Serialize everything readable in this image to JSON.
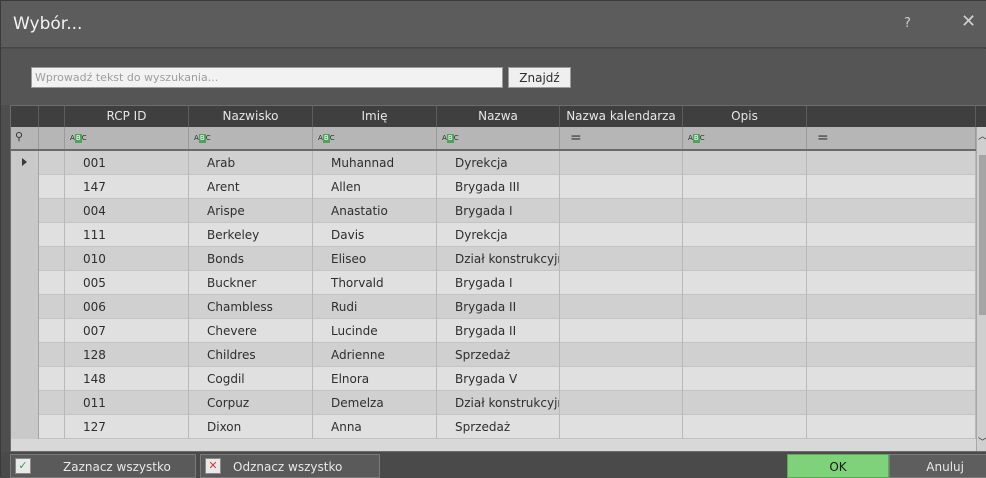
{
  "window": {
    "title": "Wybór...",
    "help_glyph": "?",
    "close_glyph": "✕"
  },
  "search": {
    "placeholder": "Wprowadź tekst do wyszukania...",
    "button_label": "Znajdź"
  },
  "grid": {
    "columns": [
      "RCP ID",
      "Nazwisko",
      "Imię",
      "Nazwa",
      "Nazwa kalendarza",
      "Opis",
      ""
    ],
    "filter_icons": [
      "abc",
      "abc",
      "abc",
      "abc",
      "equals",
      "abc",
      "equals"
    ],
    "abc_letters": [
      "A",
      "B",
      "C"
    ],
    "equals_glyph": "=",
    "pin_glyph": "⚲",
    "rows": [
      [
        "001",
        "Arab",
        "Muhannad",
        "Dyrekcja",
        "",
        "",
        ""
      ],
      [
        "147",
        "Arent",
        "Allen",
        "Brygada III",
        "",
        "",
        ""
      ],
      [
        "004",
        "Arispe",
        "Anastatio",
        "Brygada I",
        "",
        "",
        ""
      ],
      [
        "111",
        "Berkeley",
        "Davis",
        "Dyrekcja",
        "",
        "",
        ""
      ],
      [
        "010",
        "Bonds",
        "Eliseo",
        "Dział konstrukcyjny",
        "",
        "",
        ""
      ],
      [
        "005",
        "Buckner",
        "Thorvald",
        "Brygada I",
        "",
        "",
        ""
      ],
      [
        "006",
        "Chambless",
        "Rudi",
        "Brygada II",
        "",
        "",
        ""
      ],
      [
        "007",
        "Chevere",
        "Lucinde",
        "Brygada II",
        "",
        "",
        ""
      ],
      [
        "128",
        "Childres",
        "Adrienne",
        "Sprzedaż",
        "",
        "",
        ""
      ],
      [
        "148",
        "Cogdil",
        "Elnora",
        "Brygada V",
        "",
        "",
        ""
      ],
      [
        "011",
        "Corpuz",
        "Demelza",
        "Dział konstrukcyjny",
        "",
        "",
        ""
      ],
      [
        "127",
        "Dixon",
        "Anna",
        "Sprzedaż",
        "",
        "",
        ""
      ]
    ],
    "current_row": 0
  },
  "footer": {
    "select_all_label": "Zaznacz wszystko",
    "select_all_glyph": "✓",
    "deselect_all_label": "Odznacz wszystko",
    "deselect_all_glyph": "✕",
    "ok_label": "OK",
    "cancel_label": "Anuluj"
  },
  "colors": {
    "ok_button": "#7ed37a",
    "select_all_check": "#3c9a4a",
    "deselect_all_x": "#d23a3a",
    "abc_badge": "#4da35a"
  }
}
